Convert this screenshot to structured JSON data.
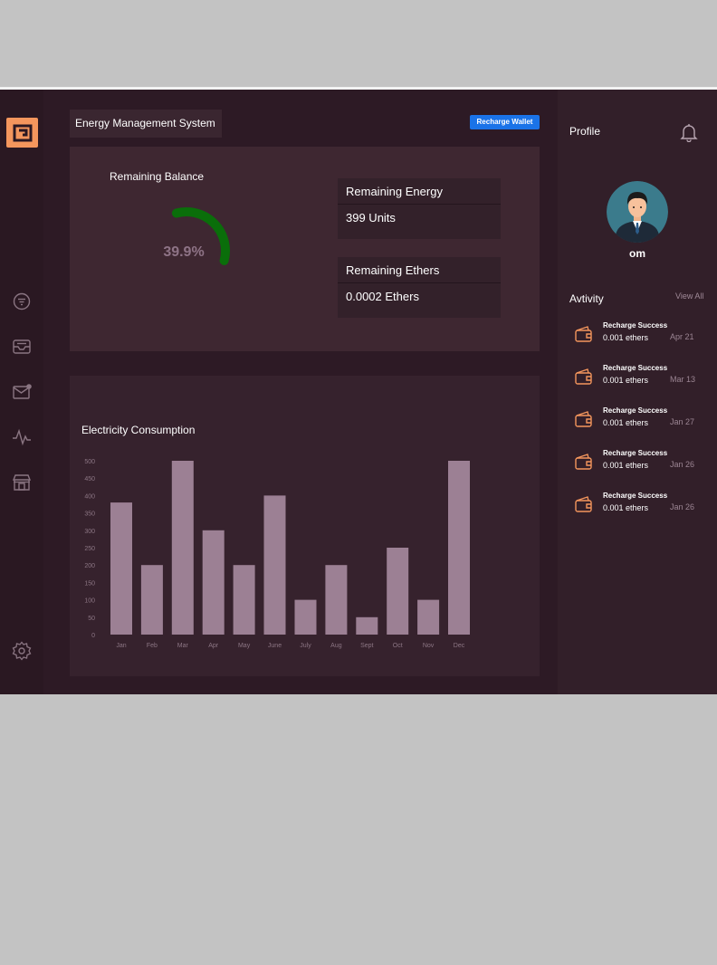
{
  "header": {
    "title": "Energy Management System",
    "recharge_button": "Recharge Wallet"
  },
  "sidebar": {
    "icons": [
      "filter-icon",
      "inbox-icon",
      "mail-icon",
      "activity-icon",
      "store-icon",
      "settings-icon"
    ]
  },
  "balance": {
    "label": "Remaining Balance",
    "percent_text": "39.9%",
    "percent_value": 39.9
  },
  "energy": {
    "title": "Remaining Energy",
    "value": "399 Units"
  },
  "ethers": {
    "title": "Remaining Ethers",
    "value": "0.0002 Ethers"
  },
  "chart_data": {
    "type": "bar",
    "title": "Electricity Consumption",
    "categories": [
      "Jan",
      "Feb",
      "Mar",
      "Apr",
      "May",
      "June",
      "July",
      "Aug",
      "Sept",
      "Oct",
      "Nov",
      "Dec"
    ],
    "values": [
      380,
      200,
      500,
      300,
      200,
      400,
      100,
      200,
      50,
      250,
      100,
      500
    ],
    "yticks": [
      0,
      50,
      100,
      150,
      200,
      250,
      300,
      350,
      400,
      450,
      500
    ],
    "ylim": [
      0,
      500
    ],
    "grid": false,
    "bar_color": "#9c8094"
  },
  "profile": {
    "label": "Profile",
    "username": "om"
  },
  "activity": {
    "label": "Avtivity",
    "view_all": "View All",
    "items": [
      {
        "title": "Recharge Success",
        "amount": "0.001 ethers",
        "date": "Apr 21"
      },
      {
        "title": "Recharge Success",
        "amount": "0.001 ethers",
        "date": "Mar 13"
      },
      {
        "title": "Recharge Success",
        "amount": "0.001 ethers",
        "date": "Jan 27"
      },
      {
        "title": "Recharge Success",
        "amount": "0.001 ethers",
        "date": "Jan 26"
      },
      {
        "title": "Recharge Success",
        "amount": "0.001 ethers",
        "date": "Jan 26"
      }
    ]
  },
  "colors": {
    "accent": "#f4965d",
    "gauge": "#0a6e0a",
    "button": "#1a73e8"
  }
}
